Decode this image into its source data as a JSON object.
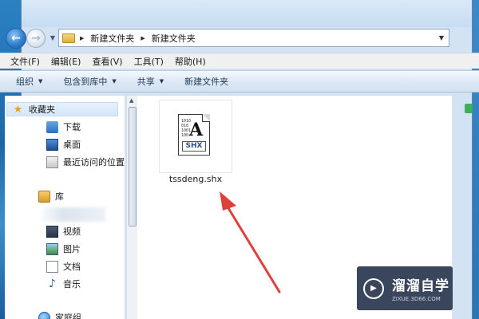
{
  "address_bar": {
    "crumbs": [
      "新建文件夹",
      "新建文件夹"
    ]
  },
  "menu": {
    "items": [
      "文件(F)",
      "编辑(E)",
      "查看(V)",
      "工具(T)",
      "帮助(H)"
    ]
  },
  "toolbar": {
    "organize": "组织",
    "include_in_library": "包含到库中",
    "share": "共享",
    "new_folder": "新建文件夹"
  },
  "nav_pane": {
    "favorites": "收藏夹",
    "downloads": "下载",
    "desktop": "桌面",
    "recent": "最近访问的位置",
    "libraries": "库",
    "videos": "视频",
    "pictures": "图片",
    "documents": "文档",
    "music": "音乐",
    "network_partial": "家庭组"
  },
  "file": {
    "name": "tssdeng.shx",
    "icon_label": "SHX",
    "icon_letter": "A",
    "icon_binary": "1010\n010\n1001\n100"
  },
  "watermark": {
    "title": "溜溜自学",
    "url": "ZIXUE.3D66.COM"
  },
  "colors": {
    "annotation_arrow": "#e0403a",
    "toolbar_bg": "#dde8f5",
    "selection": "#d4e6f9"
  },
  "icons": {
    "back": "back-arrow-icon",
    "forward": "forward-arrow-icon",
    "favorites": "star-icon",
    "music": "music-note-icon"
  }
}
